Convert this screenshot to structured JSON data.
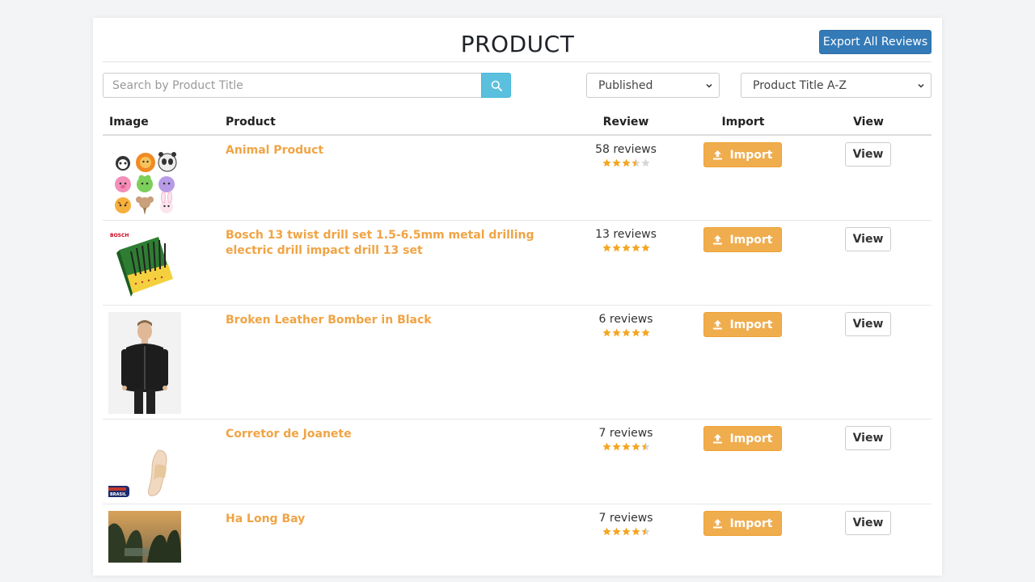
{
  "header": {
    "title": "PRODUCT",
    "export_label": "Export All Reviews"
  },
  "filters": {
    "search_placeholder": "Search by Product Title",
    "search_value": "",
    "status_selected": "Published",
    "sort_selected": "Product Title A-Z"
  },
  "table": {
    "columns": [
      "Image",
      "Product",
      "Review",
      "Import",
      "View"
    ],
    "import_label": "Import",
    "view_label": "View",
    "rows": [
      {
        "name": "Animal Product",
        "reviews": "58 reviews",
        "rating": 3.5,
        "image": "animal-stickers"
      },
      {
        "name": "Bosch 13 twist drill set 1.5-6.5mm metal drilling electric drill impact drill 13 set",
        "reviews": "13 reviews",
        "rating": 5,
        "image": "drill-set"
      },
      {
        "name": "Broken Leather Bomber in Black",
        "reviews": "6 reviews",
        "rating": 5,
        "image": "man-leather-jacket"
      },
      {
        "name": "Corretor de Joanete",
        "reviews": "7 reviews",
        "rating": 4.5,
        "image": "bunion-corrector"
      },
      {
        "name": "Ha Long Bay",
        "reviews": "7 reviews",
        "rating": 4.5,
        "image": "bay-landscape"
      }
    ]
  },
  "colors": {
    "accent_blue": "#337ab7",
    "search_button": "#5bc0de",
    "import_orange": "#f0ad4e",
    "product_link": "#f0a445",
    "star": "#f5a623"
  },
  "images": {
    "thumb_bosch": "BOSCH",
    "thumb_brasil": "BRASIL"
  }
}
